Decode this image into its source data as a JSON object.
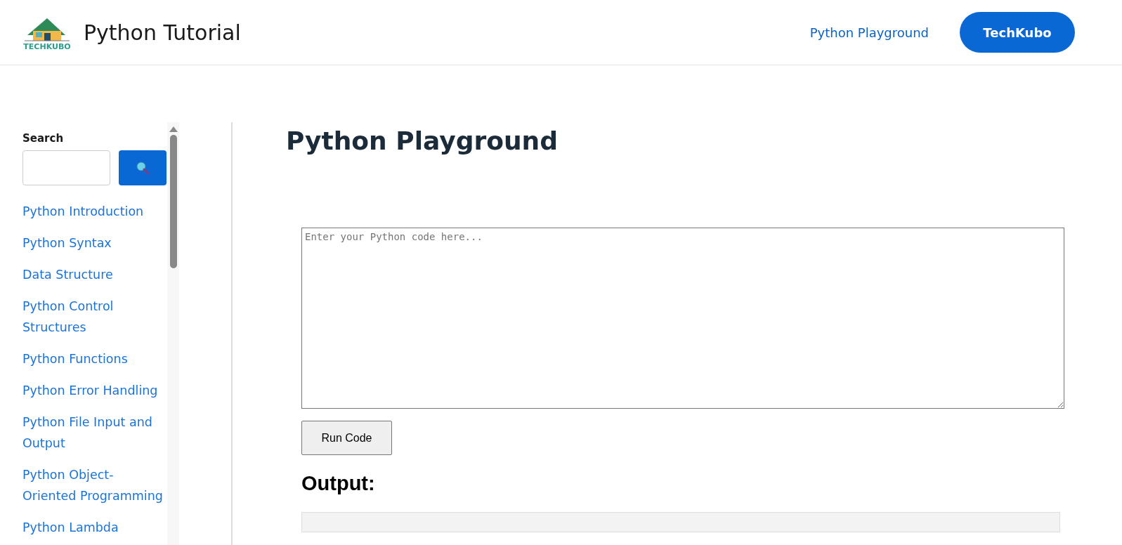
{
  "header": {
    "logo_text": "TECHKUBO",
    "title": "Python Tutorial",
    "nav_link": "Python Playground",
    "button": "TechKubo"
  },
  "sidebar": {
    "search_label": "Search",
    "items": [
      {
        "label": "Python Introduction"
      },
      {
        "label": "Python Syntax"
      },
      {
        "label": "Data Structure"
      },
      {
        "label": "Python Control Structures"
      },
      {
        "label": "Python Functions"
      },
      {
        "label": "Python Error Handling"
      },
      {
        "label": "Python File Input and Output"
      },
      {
        "label": "Python Object-Oriented Programming"
      },
      {
        "label": "Python Lambda"
      }
    ]
  },
  "main": {
    "heading": "Python Playground",
    "code_placeholder": "Enter your Python code here...",
    "run_button": "Run Code",
    "output_heading": "Output:"
  }
}
